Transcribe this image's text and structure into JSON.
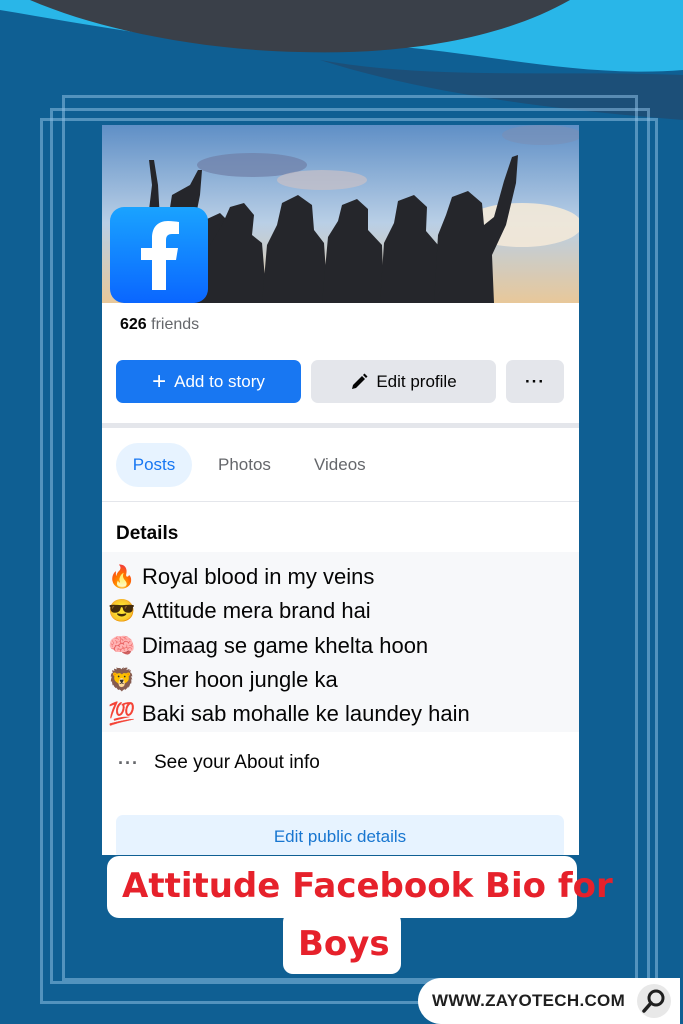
{
  "profile": {
    "friends_count": "626",
    "friends_label": "friends",
    "add_story_label": "Add to story",
    "edit_profile_label": "Edit profile",
    "more_label": "···"
  },
  "tabs": [
    {
      "label": "Posts",
      "active": true
    },
    {
      "label": "Photos",
      "active": false
    },
    {
      "label": "Videos",
      "active": false
    }
  ],
  "details": {
    "title": "Details",
    "bio_lines": [
      {
        "emoji": "🔥",
        "text": "Royal blood in my veins"
      },
      {
        "emoji": "😎",
        "text": "Attitude mera brand hai"
      },
      {
        "emoji": "🧠",
        "text": "Dimaag se game khelta hoon"
      },
      {
        "emoji": "🦁",
        "text": "Sher hoon jungle ka"
      },
      {
        "emoji": "💯",
        "text": "Baki sab mohalle ke laundey hain"
      }
    ],
    "about_label": "See your About info",
    "edit_public_label": "Edit public details"
  },
  "headline": {
    "line1": "Attitude Facebook Bio for",
    "line2": "Boys"
  },
  "footer": {
    "url": "WWW.ZAYOTECH.COM"
  },
  "colors": {
    "background": "#0f5f93",
    "facebook_blue": "#1877f2",
    "headline_red": "#e6212b"
  }
}
